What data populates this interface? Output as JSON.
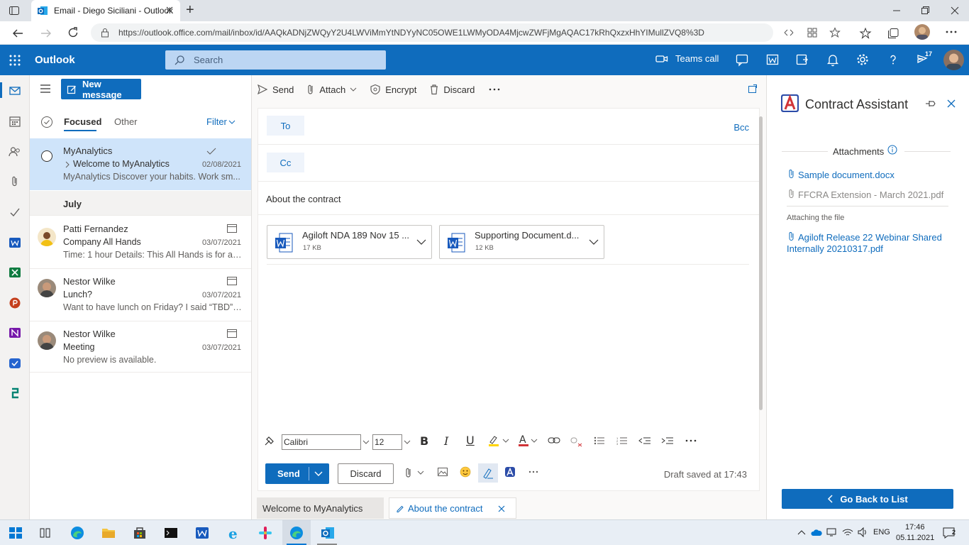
{
  "browser": {
    "tab_title": "Email - Diego Siciliani - Outlook",
    "new_tab_symbol": "+",
    "url": "https://outlook.office.com/mail/inbox/id/AAQkADNjZWQyY2U4LWViMmYtNDYyNC05OWE1LWMyODA4MjcwZWFjMgAQAC17kRhQxzxHhYIMullZVQ8%3D"
  },
  "header": {
    "app_name": "Outlook",
    "search_placeholder": "Search",
    "teams_call_label": "Teams call",
    "notification_count": "17"
  },
  "compose_left": {
    "new_message_label": "New message",
    "tabs": {
      "focused": "Focused",
      "other": "Other",
      "filter": "Filter"
    },
    "section_july": "July",
    "messages": [
      {
        "sender": "MyAnalytics",
        "subject": "Welcome to MyAnalytics",
        "date": "02/08/2021",
        "preview": "MyAnalytics Discover your habits. Work sm..."
      },
      {
        "sender": "Patti Fernandez",
        "subject": "Company All Hands",
        "date": "03/07/2021",
        "preview": "Time: 1 hour Details: This All Hands is for all..."
      },
      {
        "sender": "Nestor Wilke",
        "subject": "Lunch?",
        "date": "03/07/2021",
        "preview": "Want to have lunch on Friday? I said “TBD” f..."
      },
      {
        "sender": "Nestor Wilke",
        "subject": "Meeting",
        "date": "03/07/2021",
        "preview": "No preview is available."
      }
    ]
  },
  "compose": {
    "cmd_send": "Send",
    "cmd_attach": "Attach",
    "cmd_encrypt": "Encrypt",
    "cmd_discard": "Discard",
    "to_label": "To",
    "cc_label": "Cc",
    "bcc_label": "Bcc",
    "subject": "About the contract",
    "attachments": [
      {
        "name": "Agiloft NDA 189 Nov 15 ...",
        "size": "17 KB"
      },
      {
        "name": "Supporting Document.d...",
        "size": "12 KB"
      }
    ],
    "font_name": "Calibri",
    "font_size": "12",
    "send_label": "Send",
    "discard_label": "Discard",
    "draft_status": "Draft saved at 17:43",
    "bottom_tab_1": "Welcome to MyAnalytics",
    "bottom_tab_2": "About the contract"
  },
  "addin": {
    "title": "Contract Assistant",
    "attachments_heading": "Attachments",
    "items": [
      "Sample document.docx",
      "FFCRA Extension - March 2021.pdf"
    ],
    "attaching_heading": "Attaching the file",
    "attaching_line1": "Agiloft Release 22 Webinar Shared",
    "attaching_line2": "Internally 20210317.pdf",
    "back_label": "Go Back to List"
  },
  "taskbar": {
    "lang": "ENG",
    "time": "17:46",
    "date": "05.11.2021",
    "notif_count": "2"
  },
  "colors": {
    "brand": "#0f6cbd",
    "selected_row": "#cfe4fa"
  }
}
